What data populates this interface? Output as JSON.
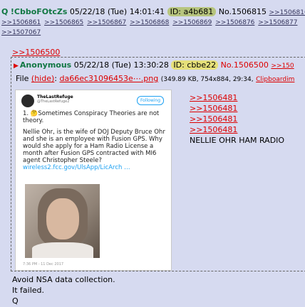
{
  "post": {
    "name": "Q",
    "tripcode": "!CbboFOtcZs",
    "datetime": "05/22/18 (Tue) 14:01:41",
    "id_label": "ID: a4b681",
    "number": "No.1506815",
    "replies_row1": [
      ">>1506816"
    ],
    "replies_row2": [
      ">>1506861",
      ">>1506865",
      ">>1506867",
      ">>1506868",
      ">>1506869",
      ">>1506876",
      ">>1506877"
    ],
    "replies_row3": [
      ">>1507067"
    ],
    "quote_link": ">>1506500",
    "message_lines": [
      "Avoid NSA data collection.",
      "It failed.",
      "Q"
    ]
  },
  "quoted": {
    "name": "Anonymous",
    "datetime": "05/22/18 (Tue) 13:30:28",
    "id_label": "ID: cbbe22",
    "number": "No.1506500",
    "backlink": ">>150",
    "file_label": "File",
    "hide_label": "(hide)",
    "file_name": "da66ec31096453e⋯.png",
    "file_info": "(349.89 KB, 754x884, 29:34,",
    "clipboard_label": "Clipboardim",
    "quote_links": [
      ">>1506481",
      ">>1506481",
      ">>1506481",
      ">>1506481"
    ],
    "message": "NELLIE OHR HAM RADIO"
  },
  "tweet": {
    "account_name": "TheLastRefuge",
    "handle": "@TheLastRefuge2",
    "follow_label": "Following",
    "line1": "1. 🤔Sometimes Conspiracy Theories are not theory.",
    "line2": "Nellie Ohr, is the wife of DOJ Deputy Bruce Ohr and she is an employee with Fusion GPS.  Why would she apply for a Ham Radio License a month after Fusion GPS contracted with MI6 agent Christopher Steele?",
    "link": "wireless2.fcc.gov/UlsApp/LicArch …",
    "footer": "7:36 PM - 11 Dec 2017"
  }
}
